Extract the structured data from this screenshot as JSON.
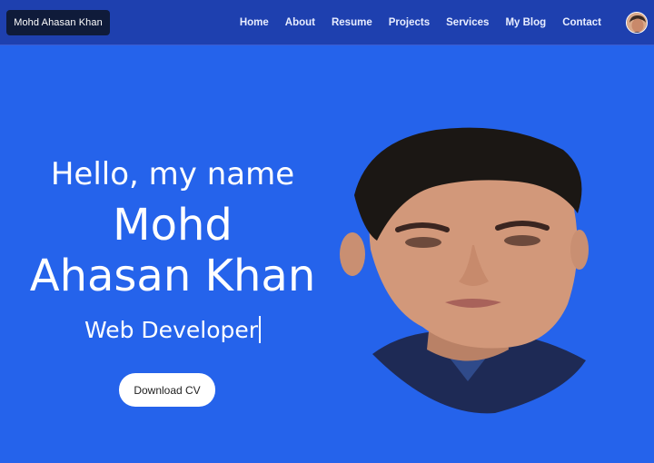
{
  "navbar": {
    "brand": "Mohd Ahasan Khan",
    "links": [
      "Home",
      "About",
      "Resume",
      "Projects",
      "Services",
      "My Blog",
      "Contact"
    ],
    "avatar_icon": "profile-avatar"
  },
  "hero": {
    "greeting": "Hello, my name",
    "name_line1": "Mohd",
    "name_line2": "Ahasan Khan",
    "role": "Web Developer",
    "cta_label": "Download CV"
  },
  "colors": {
    "background": "#2563EB",
    "navbar": "#1E40AF",
    "brand_bg": "#0F1B3A",
    "button_bg": "#FFFFFF"
  }
}
